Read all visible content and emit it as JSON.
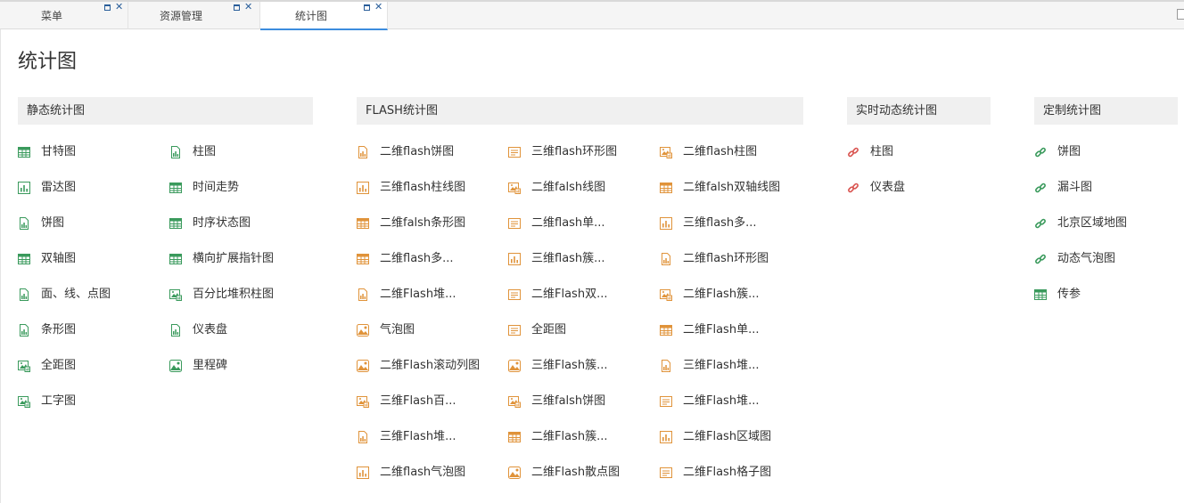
{
  "tabs": [
    {
      "label": "菜单"
    },
    {
      "label": "资源管理"
    },
    {
      "label": "统计图"
    }
  ],
  "page_title": "统计图",
  "colors": {
    "green": "#3a9a5c",
    "orange": "#e0933a",
    "red": "#d9534f",
    "tab_accent": "#3c8dde"
  },
  "groups": [
    {
      "title": "静态统计图",
      "items": [
        {
          "label": "甘特图",
          "icon": "table-icon"
        },
        {
          "label": "柱图",
          "icon": "document-chart-icon"
        },
        {
          "label": "雷达图",
          "icon": "bar-chart-icon"
        },
        {
          "label": "时间走势",
          "icon": "table-icon"
        },
        {
          "label": "饼图",
          "icon": "document-chart-icon"
        },
        {
          "label": "时序状态图",
          "icon": "table-icon"
        },
        {
          "label": "双轴图",
          "icon": "table-icon"
        },
        {
          "label": "横向扩展指针图",
          "icon": "table-icon"
        },
        {
          "label": "面、线、点图",
          "icon": "document-chart-icon"
        },
        {
          "label": "百分比堆积柱图",
          "icon": "image-chart-icon"
        },
        {
          "label": "条形图",
          "icon": "document-chart-icon"
        },
        {
          "label": "仪表盘",
          "icon": "document-chart-icon"
        },
        {
          "label": "全距图",
          "icon": "image-chart-icon"
        },
        {
          "label": "里程碑",
          "icon": "picture-icon"
        },
        {
          "label": "工字图",
          "icon": "image-chart-icon"
        }
      ]
    },
    {
      "title": "FLASH统计图",
      "items": [
        {
          "label": "二维flash饼图",
          "icon": "document-chart-icon"
        },
        {
          "label": "三维flash环形图",
          "icon": "text-lines-icon"
        },
        {
          "label": "二维flash柱图",
          "icon": "image-chart-icon"
        },
        {
          "label": "三维flash柱线图",
          "icon": "bar-chart-icon"
        },
        {
          "label": "二维falsh线图",
          "icon": "image-chart-icon"
        },
        {
          "label": "二维falsh双轴线图",
          "icon": "table-icon"
        },
        {
          "label": "二维falsh条形图",
          "icon": "table-icon"
        },
        {
          "label": "二维flash单...",
          "icon": "text-lines-icon"
        },
        {
          "label": "三维flash多...",
          "icon": "bar-chart-icon"
        },
        {
          "label": "二维flash多...",
          "icon": "table-icon"
        },
        {
          "label": "三维flash簇...",
          "icon": "bar-chart-icon"
        },
        {
          "label": "二维flash环形图",
          "icon": "document-chart-icon"
        },
        {
          "label": "二维Flash堆...",
          "icon": "document-chart-icon"
        },
        {
          "label": "二维Flash双...",
          "icon": "text-lines-icon"
        },
        {
          "label": "二维Flash簇...",
          "icon": "image-chart-icon"
        },
        {
          "label": "气泡图",
          "icon": "picture-icon"
        },
        {
          "label": "全距图",
          "icon": "text-lines-icon"
        },
        {
          "label": "二维Flash单...",
          "icon": "table-icon"
        },
        {
          "label": "二维Flash滚动列图",
          "icon": "picture-icon"
        },
        {
          "label": "三维Flash簇...",
          "icon": "picture-icon"
        },
        {
          "label": "三维Flash堆...",
          "icon": "document-chart-icon"
        },
        {
          "label": "三维Flash百...",
          "icon": "image-chart-icon"
        },
        {
          "label": "三维falsh饼图",
          "icon": "image-chart-icon"
        },
        {
          "label": "二维Flash堆...",
          "icon": "text-lines-icon"
        },
        {
          "label": "三维Flash堆...",
          "icon": "document-chart-icon"
        },
        {
          "label": "二维Flash簇...",
          "icon": "table-icon"
        },
        {
          "label": "二维Flash区域图",
          "icon": "bar-chart-icon"
        },
        {
          "label": "二维flash气泡图",
          "icon": "bar-chart-icon"
        },
        {
          "label": "二维Flash散点图",
          "icon": "picture-icon"
        },
        {
          "label": "二维Flash格子图",
          "icon": "text-lines-icon"
        }
      ]
    },
    {
      "title": "实时动态统计图",
      "items": [
        {
          "label": "柱图",
          "icon": "link-icon"
        },
        {
          "label": "仪表盘",
          "icon": "link-icon"
        }
      ]
    },
    {
      "title": "定制统计图",
      "items": [
        {
          "label": "饼图",
          "icon": "link-icon"
        },
        {
          "label": "漏斗图",
          "icon": "link-icon"
        },
        {
          "label": "北京区域地图",
          "icon": "link-icon"
        },
        {
          "label": "动态气泡图",
          "icon": "link-icon"
        },
        {
          "label": "传参",
          "icon": "table-icon"
        }
      ]
    }
  ]
}
